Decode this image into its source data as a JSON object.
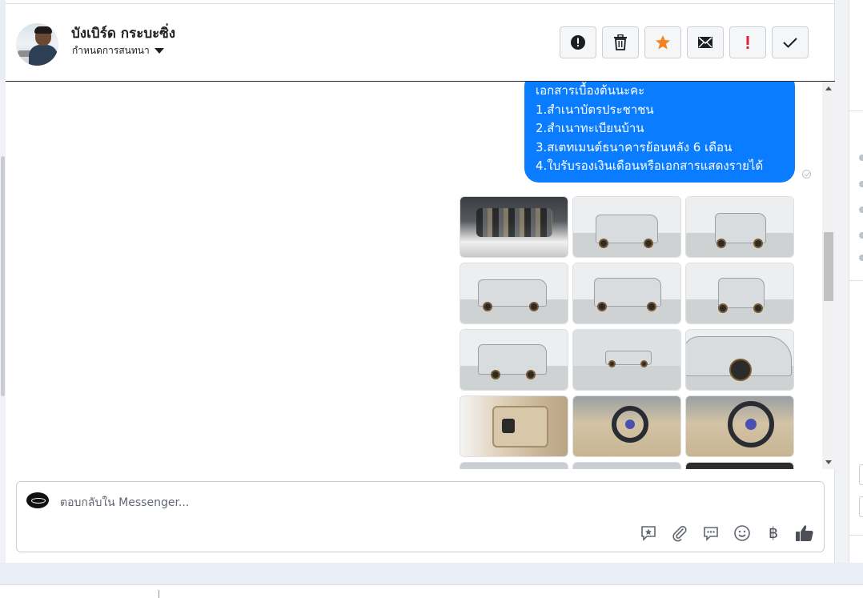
{
  "header": {
    "name": "บังเบิร์ด กระบะซิ่ง",
    "assign_label": "กำหนดการสนทนา"
  },
  "actions": [
    {
      "id": "report",
      "icon": "alert-circle-icon"
    },
    {
      "id": "delete",
      "icon": "trash-icon"
    },
    {
      "id": "star",
      "icon": "star-icon",
      "color": "#f5821f"
    },
    {
      "id": "mark-unread",
      "icon": "envelope-icon"
    },
    {
      "id": "follow-up",
      "icon": "exclamation-icon",
      "color": "#e41e3f"
    },
    {
      "id": "done",
      "icon": "check-icon"
    }
  ],
  "message": {
    "lines": [
      "เอกสารเบื้องต้นนะคะ",
      "1.สำเนาบัตรประชาชน",
      "2.สำเนาทะเบียนบ้าน",
      "3.สเตทเมนต์ธนาคารย้อนหลัง 6 เดือน",
      "4.ใบรับรองเงินเดือนหรือเอกสารแสดงรายได้"
    ],
    "bubble_color": "#0a7cff"
  },
  "photos": [
    "engine",
    "truck-front",
    "truck-front-2",
    "truck-side-front",
    "truck-rear",
    "truck-rear-2",
    "truck-rear-side",
    "truck-side-far",
    "truck-closeup",
    "door-panel",
    "dashboard",
    "steering-wheel",
    "partial-1",
    "partial-2",
    "partial-3"
  ],
  "composer": {
    "placeholder": "ตอบกลับใน Messenger...",
    "tools": [
      "saved-reply-icon",
      "attachment-icon",
      "chat-bubble-icon",
      "emoji-icon",
      "baht-icon",
      "thumbs-up-icon"
    ],
    "baht_symbol": "฿",
    "like_color": "#4b4f56"
  }
}
